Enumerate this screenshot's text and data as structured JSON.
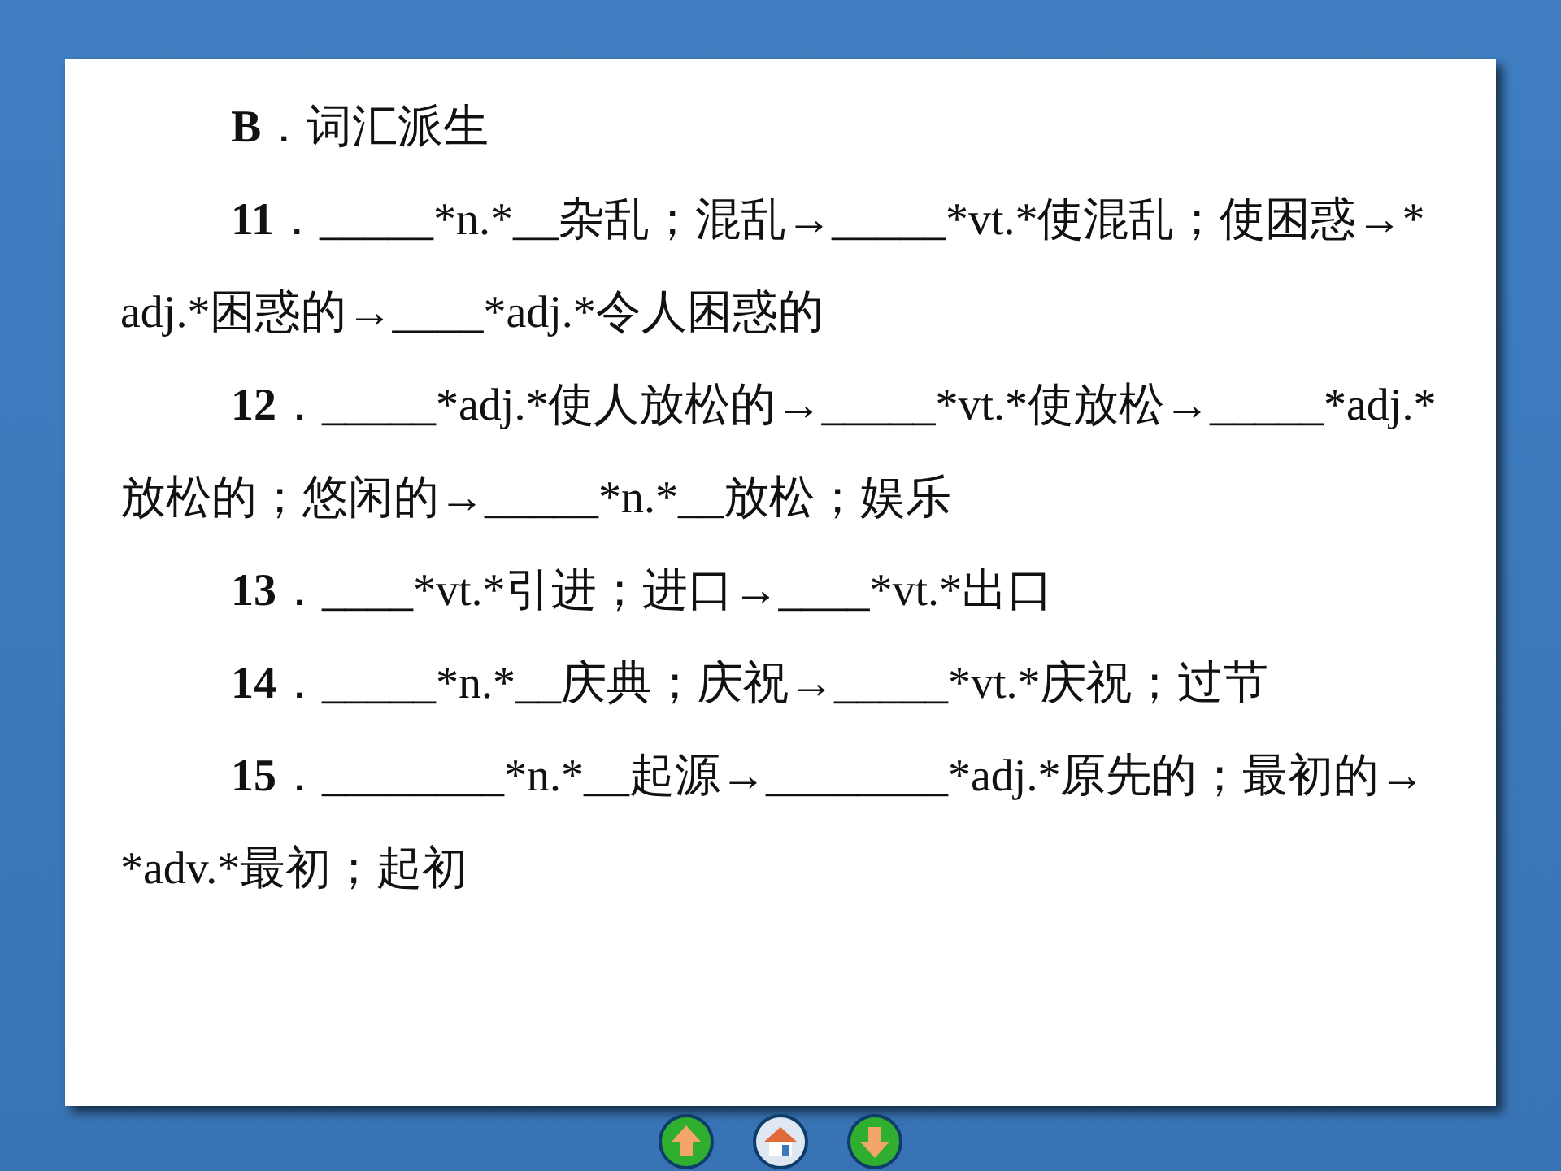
{
  "heading": "**B**．词汇派生",
  "items": [
    "**11**．_____*n.*__杂乱；混乱→_____*vt.*使混乱；使困惑→*adj.*困惑的→____*adj.*令人困惑的",
    "**12**．_____*adj.*使人放松的→_____*vt.*使放松→_____*adj.*放松的；悠闲的→_____*n.*__放松；娱乐",
    "**13**．____*vt.*引进；进口→____*vt.*出口",
    "**14**．_____*n.*__庆典；庆祝→_____*vt.*庆祝；过节",
    "**15**．________*n.*__起源→________*adj.*原先的；最初的→*adv.*最初；起初"
  ]
}
